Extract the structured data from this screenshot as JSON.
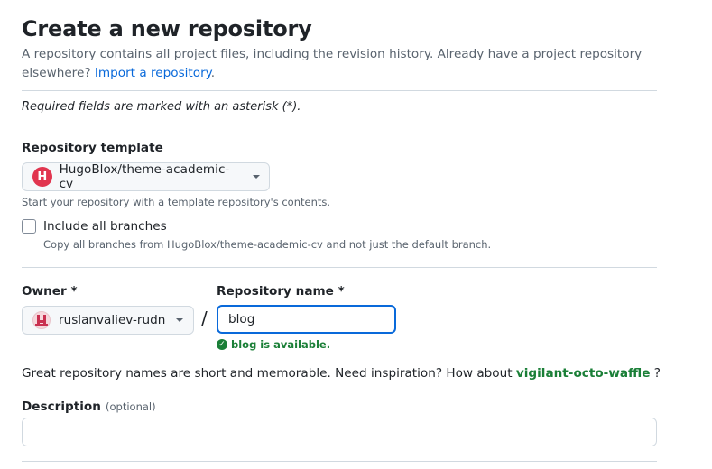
{
  "header": {
    "title": "Create a new repository",
    "description_line1": "A repository contains all project files, including the revision history. Already have a project repository",
    "description_line2_prefix": "elsewhere?",
    "import_link": "Import a repository",
    "description_line2_suffix": "."
  },
  "required_note": "Required fields are marked with an asterisk (*).",
  "template": {
    "label": "Repository template",
    "selected": "HugoBlox/theme-academic-cv",
    "logo_letter": "H",
    "help": "Start your repository with a template repository's contents."
  },
  "include_branches": {
    "label": "Include all branches",
    "help": "Copy all branches from HugoBlox/theme-academic-cv and not just the default branch.",
    "checked": false
  },
  "owner": {
    "label": "Owner *",
    "value": "ruslanvaliev-rudn"
  },
  "separator": "/",
  "repo_name": {
    "label": "Repository name *",
    "value": "blog",
    "status": "blog is available."
  },
  "suggestion": {
    "text": "Great repository names are short and memorable. Need inspiration? How about",
    "name": "vigilant-octo-waffle",
    "suffix": "?"
  },
  "description": {
    "label": "Description",
    "optional": "(optional)",
    "value": ""
  },
  "colors": {
    "accent_blue": "#0969da",
    "success_green": "#1a7f37",
    "template_logo": "#e1354f"
  }
}
